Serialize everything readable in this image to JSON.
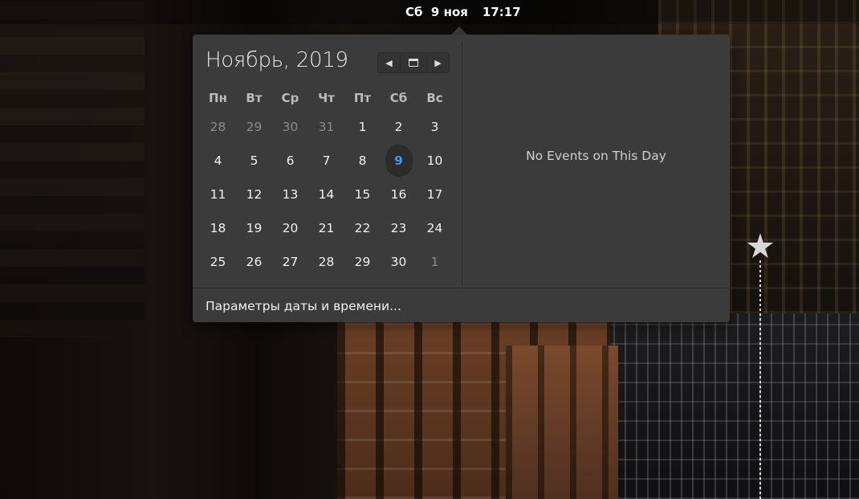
{
  "panel": {
    "date": "Сб  9 ноя",
    "time": "17:17"
  },
  "calendar": {
    "month_title": "Ноябрь, 2019",
    "nav": {
      "prev_icon": "chevron-left-icon",
      "today_icon": "calendar-icon",
      "next_icon": "chevron-right-icon"
    },
    "weekdays": [
      "Пн",
      "Вт",
      "Ср",
      "Чт",
      "Пт",
      "Сб",
      "Вс"
    ],
    "weeks": [
      [
        {
          "d": "28",
          "other": true
        },
        {
          "d": "29",
          "other": true
        },
        {
          "d": "30",
          "other": true
        },
        {
          "d": "31",
          "other": true
        },
        {
          "d": "1"
        },
        {
          "d": "2"
        },
        {
          "d": "3"
        }
      ],
      [
        {
          "d": "4"
        },
        {
          "d": "5"
        },
        {
          "d": "6"
        },
        {
          "d": "7"
        },
        {
          "d": "8"
        },
        {
          "d": "9",
          "selected": true
        },
        {
          "d": "10"
        }
      ],
      [
        {
          "d": "11"
        },
        {
          "d": "12"
        },
        {
          "d": "13"
        },
        {
          "d": "14"
        },
        {
          "d": "15"
        },
        {
          "d": "16"
        },
        {
          "d": "17"
        }
      ],
      [
        {
          "d": "18"
        },
        {
          "d": "19"
        },
        {
          "d": "20"
        },
        {
          "d": "21"
        },
        {
          "d": "22"
        },
        {
          "d": "23"
        },
        {
          "d": "24"
        }
      ],
      [
        {
          "d": "25"
        },
        {
          "d": "26"
        },
        {
          "d": "27"
        },
        {
          "d": "28"
        },
        {
          "d": "29"
        },
        {
          "d": "30"
        },
        {
          "d": "1",
          "other": true
        }
      ]
    ],
    "selected_color": "#3d9ae8"
  },
  "events": {
    "empty_text": "No Events on This Day"
  },
  "footer": {
    "settings_label": "Параметры даты и времени..."
  }
}
